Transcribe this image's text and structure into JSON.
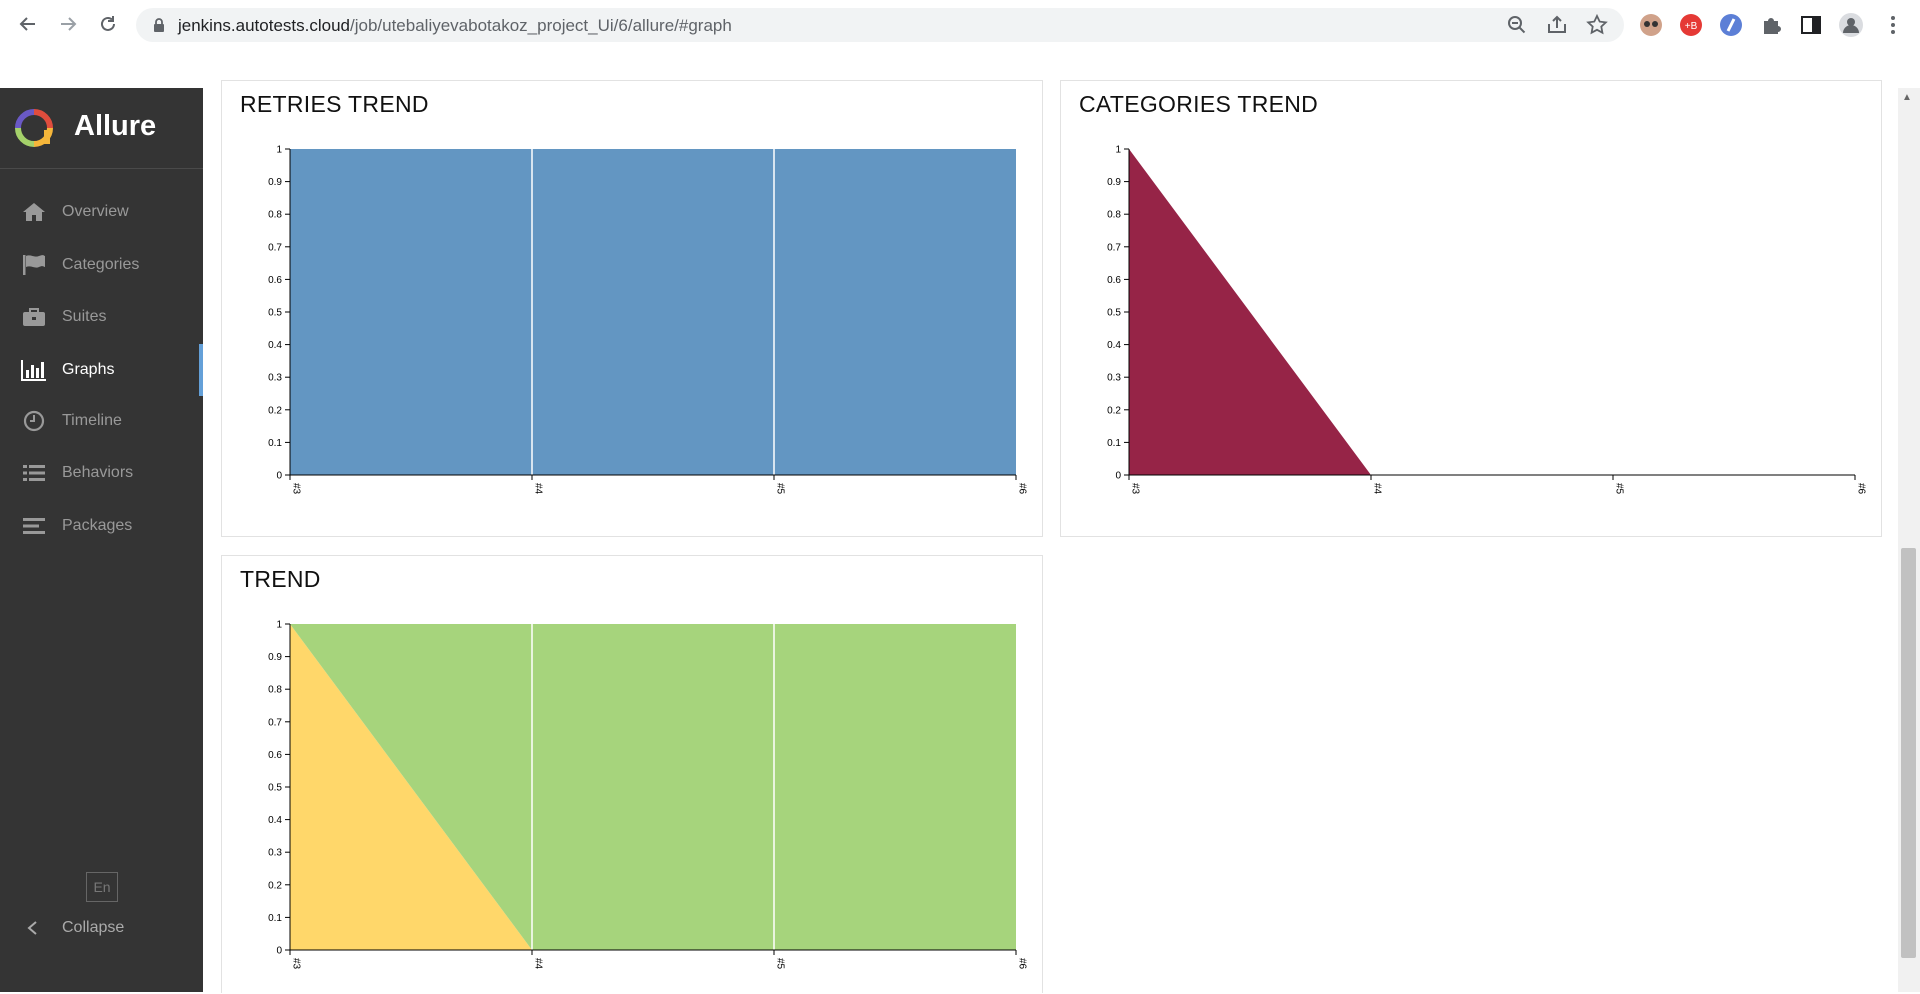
{
  "browser": {
    "url_host": "jenkins.autotests.cloud",
    "url_path": "/job/utebaliyevabotakoz_project_Ui/6/allure/#graph",
    "icons": [
      "back-icon",
      "forward-icon",
      "reload-icon",
      "lock-icon",
      "zoom-icon",
      "share-icon",
      "star-icon",
      "extension-icon",
      "puzzle-icon",
      "sidepanel-icon",
      "profile-icon",
      "menu-icon"
    ]
  },
  "sidebar": {
    "brand": "Allure",
    "items": [
      {
        "label": "Overview",
        "icon": "home-icon",
        "active": false
      },
      {
        "label": "Categories",
        "icon": "flag-icon",
        "active": false
      },
      {
        "label": "Suites",
        "icon": "briefcase-icon",
        "active": false
      },
      {
        "label": "Graphs",
        "icon": "bar-chart-icon",
        "active": true
      },
      {
        "label": "Timeline",
        "icon": "clock-icon",
        "active": false
      },
      {
        "label": "Behaviors",
        "icon": "list-icon",
        "active": false
      },
      {
        "label": "Packages",
        "icon": "align-left-icon",
        "active": false
      }
    ],
    "language": "En",
    "collapse": "Collapse"
  },
  "panels": {
    "retries": {
      "title": "RETRIES TREND"
    },
    "categories": {
      "title": "CATEGORIES TREND"
    },
    "trend": {
      "title": "TREND"
    }
  },
  "colors": {
    "retries": "#6396c2",
    "categories": "#962447",
    "passed": "#a6d47c",
    "broken": "#ffd76a",
    "accent": "#64a0d8"
  },
  "chart_data": [
    {
      "type": "area",
      "title": "RETRIES TREND",
      "x": [
        "#3",
        "#4",
        "#5",
        "#6"
      ],
      "series": [
        {
          "values": [
            1,
            1,
            1,
            1
          ]
        }
      ],
      "ylim": [
        0,
        1
      ],
      "yticks": [
        "0",
        "0.1",
        "0.2",
        "0.3",
        "0.4",
        "0.5",
        "0.6",
        "0.7",
        "0.8",
        "0.9",
        "1"
      ]
    },
    {
      "type": "area",
      "title": "CATEGORIES TREND",
      "x": [
        "#3",
        "#4",
        "#5",
        "#6"
      ],
      "series": [
        {
          "values": [
            1,
            0,
            0,
            0
          ]
        }
      ],
      "ylim": [
        0,
        1
      ],
      "yticks": [
        "0",
        "0.1",
        "0.2",
        "0.3",
        "0.4",
        "0.5",
        "0.6",
        "0.7",
        "0.8",
        "0.9",
        "1"
      ]
    },
    {
      "type": "area",
      "title": "TREND",
      "stacked": true,
      "x": [
        "#3",
        "#4",
        "#5",
        "#6"
      ],
      "series": [
        {
          "values": [
            1,
            0,
            0,
            0
          ]
        },
        {
          "values": [
            0,
            1,
            1,
            1
          ]
        }
      ],
      "ylim": [
        0,
        1
      ],
      "yticks": [
        "0",
        "0.1",
        "0.2",
        "0.3",
        "0.4",
        "0.5",
        "0.6",
        "0.7",
        "0.8",
        "0.9",
        "1"
      ]
    }
  ]
}
